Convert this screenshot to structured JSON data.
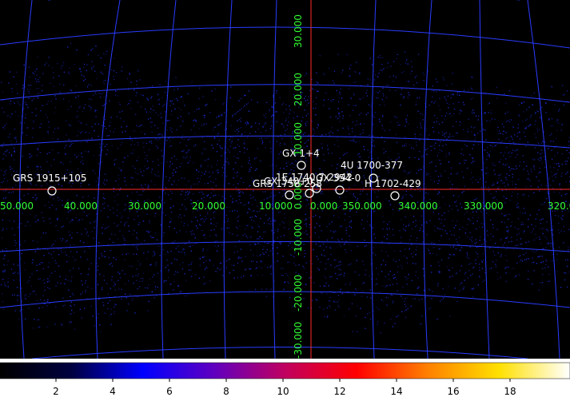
{
  "colors": {
    "background": "#000000",
    "grid": "#2a3cff",
    "axis": "#ff2a2a",
    "axis_label": "#33ff33",
    "source_marker": "#ffffff",
    "noise": "#2233ff"
  },
  "longitude_labels": [
    "50.000",
    "40.000",
    "30.000",
    "20.000",
    "10.000",
    "0.000",
    "350.000",
    "340.000",
    "330.000",
    "320.000"
  ],
  "latitude_labels": [
    "30.000",
    "20.000",
    "10.000",
    "0.000",
    "-10.000",
    "-20.000",
    "-30.000"
  ],
  "sources": [
    {
      "name": "GX 1+4"
    },
    {
      "name": "4U 1700-377"
    },
    {
      "name": "GRS 1915+105"
    },
    {
      "name": "1E 1740.7-2942"
    },
    {
      "name": "GX 354-0"
    },
    {
      "name": "GRS 1758-258"
    },
    {
      "name": "GX 340+0"
    },
    {
      "name": "H 1702-429"
    }
  ],
  "colorbar": {
    "ticks": [
      "2",
      "4",
      "6",
      "8",
      "10",
      "12",
      "14",
      "16",
      "18"
    ],
    "colormap": [
      "#000000",
      "#000040",
      "#0000ff",
      "#6000c0",
      "#c00060",
      "#ff0000",
      "#ff8000",
      "#ffe000",
      "#ffffff"
    ]
  }
}
